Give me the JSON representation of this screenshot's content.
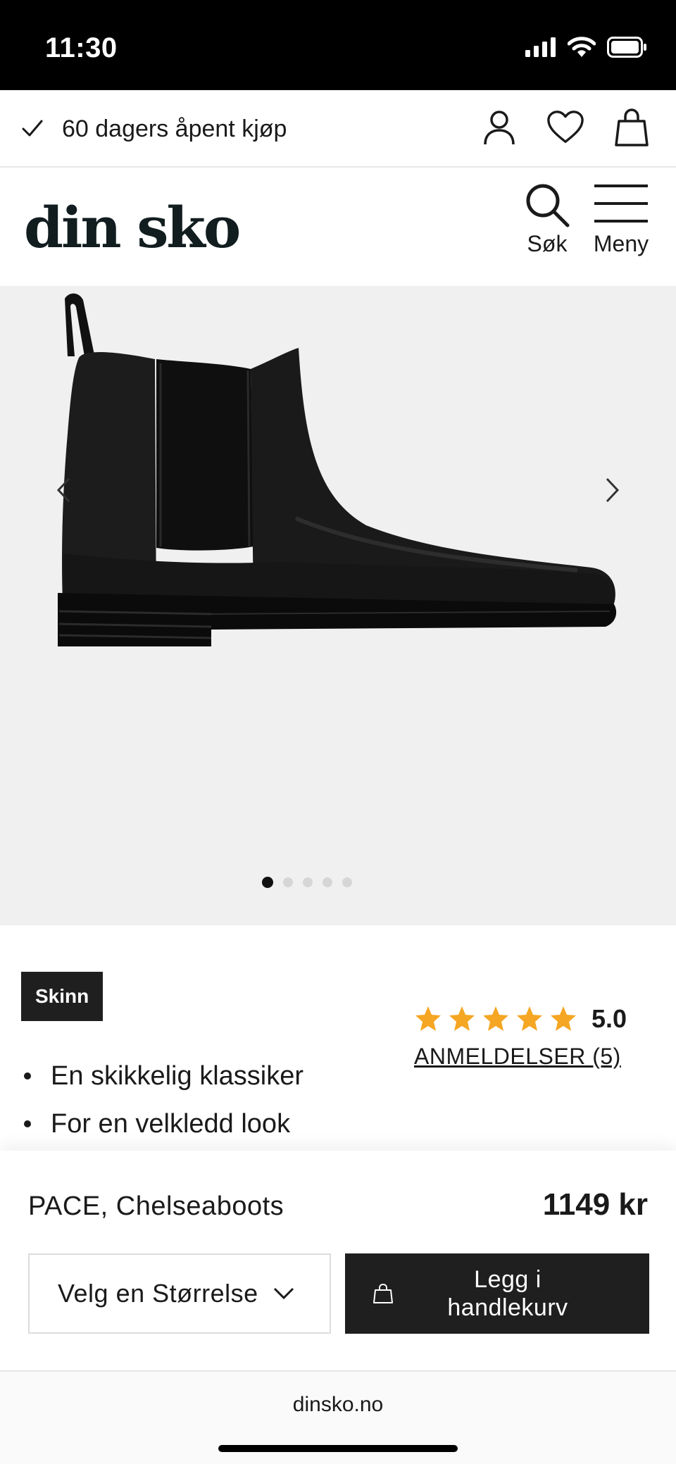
{
  "status_bar": {
    "time": "11:30"
  },
  "usp": {
    "text": "60 dagers åpent kjøp"
  },
  "header": {
    "logo": "din sko",
    "search_label": "Søk",
    "menu_label": "Meny"
  },
  "gallery": {
    "image_count": 5,
    "active_index": 0
  },
  "product": {
    "tag": "Skinn",
    "features": [
      "En skikkelig klassiker",
      "For en velkledd look"
    ],
    "rating": {
      "value": "5.0",
      "stars": 5,
      "star_color": "#f5a623"
    },
    "reviews_link": "ANMELDELSER (5)",
    "name": "PACE, Chelseaboots",
    "price": "1149 kr"
  },
  "buy": {
    "size_placeholder": "Velg en Størrelse",
    "add_to_cart_line1": "Legg i",
    "add_to_cart_line2": "handlekurv"
  },
  "browser": {
    "url": "dinsko.no"
  },
  "colors": {
    "dark": "#1f1f1f",
    "gallery_bg": "#f0f0f0",
    "logo": "#121d1f"
  }
}
